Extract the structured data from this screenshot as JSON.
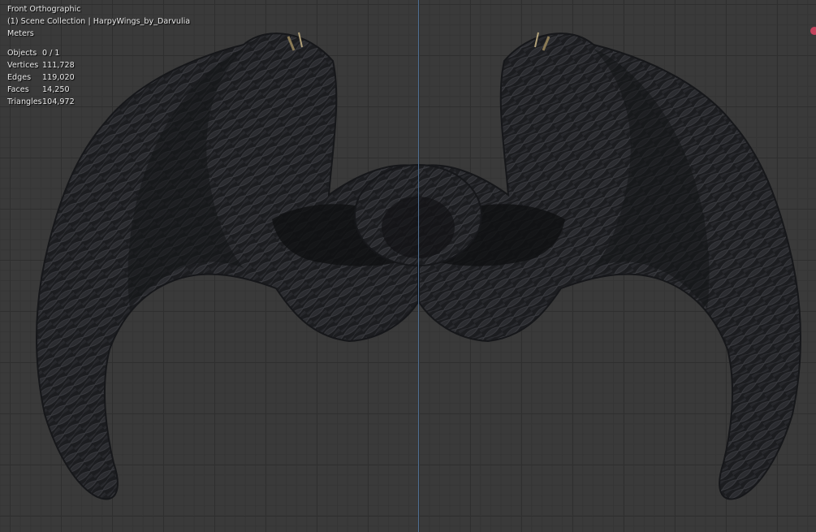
{
  "viewport": {
    "view_name": "Front Orthographic",
    "collection": "(1) Scene Collection | HarpyWings_by_Darvulia",
    "units": "Meters"
  },
  "stats": [
    {
      "label": "Objects",
      "value": "0 / 1"
    },
    {
      "label": "Vertices",
      "value": "111,728"
    },
    {
      "label": "Edges",
      "value": "119,020"
    },
    {
      "label": "Faces",
      "value": "14,250"
    },
    {
      "label": "Triangles",
      "value": "104,972"
    }
  ],
  "colors": {
    "background": "#3a3a3a",
    "grid_line": "#2f2f2f",
    "z_axis": "#4f6f93",
    "gizmo_x": "#c3425c"
  },
  "model": {
    "icon": "feathered-wings-mesh-icon"
  }
}
